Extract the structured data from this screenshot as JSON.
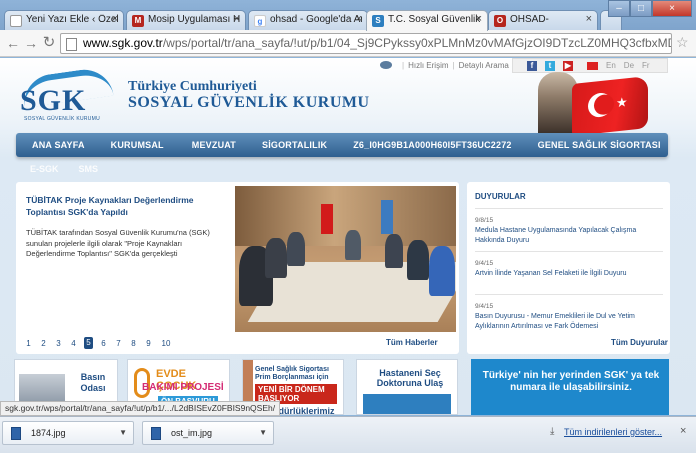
{
  "browser": {
    "tabs": [
      {
        "title": "Yeni Yazı Ekle ‹ Özel Ha",
        "icon": "page-icon",
        "color": "#ffffff"
      },
      {
        "title": "Mosip Uygulaması Haz",
        "icon": "mosip-icon",
        "color": "#b5261e"
      },
      {
        "title": "ohsad - Google'da Ara",
        "icon": "google-icon",
        "color": "#4285f4"
      },
      {
        "title": "T.C. Sosyal Güvenlik Ku",
        "icon": "sgk-icon",
        "color": "#2e7fbf"
      },
      {
        "title": "OHSAD-",
        "icon": "ohsad-icon",
        "color": "#b5261e"
      }
    ],
    "url_domain": "www.sgk.gov.tr",
    "url_path": "/wps/portal/tr/ana_sayfa/!ut/p/b1/04_Sj9CPykssy0xPLMnMz0vMAfGjzOI9DTzcLZ0MHQ3cfbxMDTx9HN3cv"
  },
  "header": {
    "logo": "SGK",
    "logo_sub": "SOSYAL GÜVENLİK KURUMU",
    "title": "Türkiye Cumhuriyeti",
    "subtitle": "SOSYAL GÜVENLİK KURUMU",
    "fast_access": "Hızlı Erişim",
    "detailed_search": "Detaylı Arama",
    "langs": [
      "En",
      "De",
      "Fr"
    ]
  },
  "nav": {
    "items": [
      "ANA SAYFA",
      "KURUMSAL",
      "MEVZUAT",
      "SİGORTALILIK",
      "Z6_I0HG9B1A000H60I5FT36UC2272",
      "GENEL SAĞLIK SİGORTASI"
    ],
    "sub_items": [
      "E-SGK",
      "SMS"
    ]
  },
  "news": {
    "title": "TÜBİTAK Proje Kaynakları Değerlendirme Toplantısı SGK'da Yapıldı",
    "text": "TÜBİTAK tarafından Sosyal Güvenlik Kurumu'na (SGK) sunulan projelerle ilgili olarak \"Proje Kaynakları Değerlendirme Toplantısı\" SGK'da gerçekleşti",
    "pages": [
      "1",
      "2",
      "3",
      "4",
      "5",
      "6",
      "7",
      "8",
      "9",
      "10"
    ],
    "active_page": "5",
    "all_label": "Tüm Haberler"
  },
  "announcements": {
    "title": "DUYURULAR",
    "items": [
      {
        "date": "9/8/15",
        "text": "Medula Hastane Uygulamasında Yapılacak Çalışma Hakkında Duyuru"
      },
      {
        "date": "9/4/15",
        "text": "Artvin İlinde Yaşanan Sel Felaketi ile İlgili Duyuru"
      },
      {
        "date": "9/4/15",
        "text": "Basın Duyurusu - Memur Emeklileri ile Dul ve Yetim Aylıklarının Artırılması ve Fark Ödemesi"
      }
    ],
    "all_label": "Tüm Duyurular"
  },
  "boxes": {
    "basin": "Basın Odası",
    "evde_1": "EVDE ÇOCUK",
    "evde_2": "BAKIMI PROJESİ",
    "evde_3": "ÖN BAŞVURU",
    "gss_1": "Genel Sağlık Sigortası Prim Borçlanması için",
    "gss_2": "YENİ BİR DÖNEM BAŞLIYOR",
    "hastane": "Hastaneni Seç Doktoruna Ulaş",
    "turkiye": "Türkiye' nin her yerinden SGK' ya tek numara ile ulaşabilirsiniz.",
    "mudur": "İl Müdürlüklerimiz"
  },
  "status_url": "sgk.gov.tr/wps/portal/tr/ana_sayfa/!ut/p/b1/.../L2dBISEvZ0FBIS9nQSEh/",
  "downloads": {
    "items": [
      "1874.jpg",
      "ost_im.jpg"
    ],
    "show_all": "Tüm indirilenleri göster..."
  }
}
